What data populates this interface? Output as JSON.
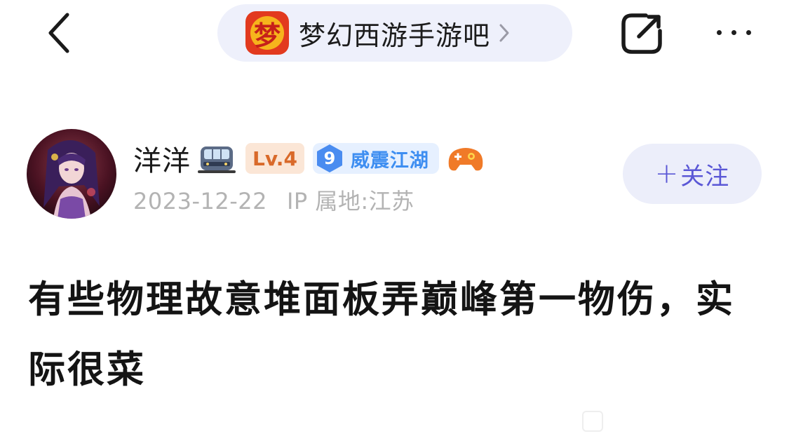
{
  "nav": {
    "forum_name": "梦幻西游手游吧",
    "forum_logo_glyph": "梦",
    "icons": {
      "back": "back-arrow-icon",
      "chevron": "chevron-right-icon",
      "share": "share-icon",
      "more": "more-dots-icon"
    }
  },
  "author": {
    "name": "洋洋",
    "level_label": "Lv.4",
    "rank_number": "9",
    "rank_title": "威震江湖",
    "date": "2023-12-22",
    "ip_location": "IP 属地:江苏",
    "icons": {
      "avatar": "anime-character-avatar",
      "badge_1": "train-icon",
      "badge_2": "game-controller-icon"
    }
  },
  "follow_button": {
    "plus": "+",
    "label": "关注"
  },
  "post": {
    "title": "有些物理故意堆面板弄巅峰第一物伤，实际很菜"
  },
  "colors": {
    "accent": "#5a57d6",
    "pill_bg": "#eef0fb",
    "level_text": "#d96a2a",
    "rank_text": "#3e8ef1",
    "meta_text": "#b3b3b3"
  }
}
